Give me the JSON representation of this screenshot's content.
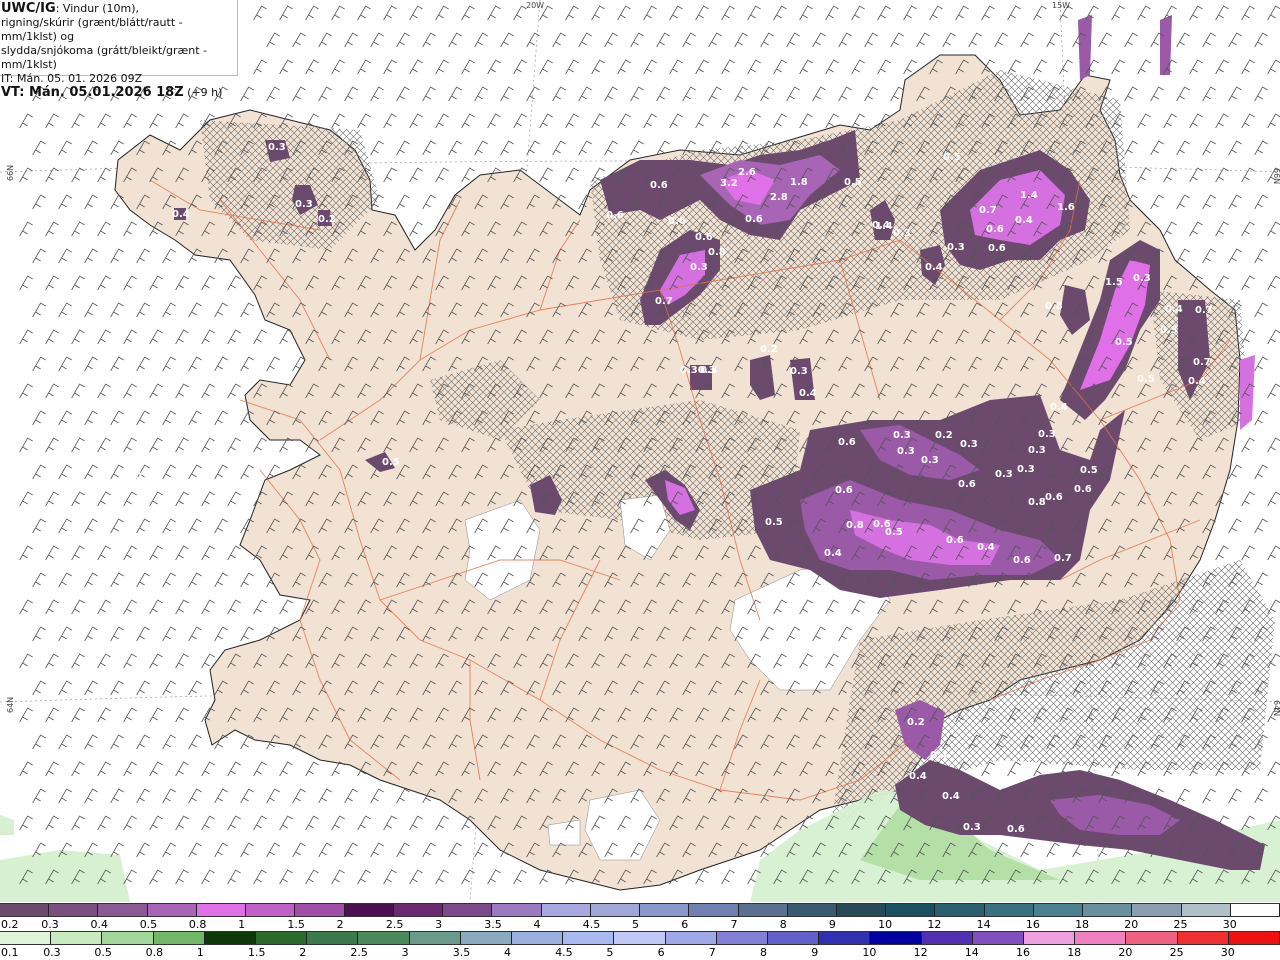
{
  "header": {
    "model": "UWC/IG",
    "line1_rest": ": Vindur (10m),",
    "line2": "rigning/skúrir (grænt/blátt/rautt - mm/1klst) og",
    "line3": "slydda/snjókoma (grátt/bleikt/grænt - mm/1klst)",
    "init": "IT: Mán. 05. 01. 2026 09Z",
    "valid": "VT: Mán. 05.01.2026 18Z",
    "lead": "(+9 h)"
  },
  "coords": {
    "lon_20w": "20W",
    "lon_15w": "15W",
    "lat_66n_left": "66N",
    "lat_66n_right": "66N",
    "lat_64n_left": "64N",
    "lat_64n_right": "64N"
  },
  "colors": {
    "sea": "#ffffff",
    "land": "#f2e2d3",
    "roads": "#e2714a",
    "glacier": "#ffffff",
    "snow_light": "#6b4a6e",
    "snow_mid": "#9a5aa8",
    "snow_heavy": "#d470e0",
    "snow_peak": "#f080f0",
    "rain_light": "#d6f0d0",
    "rain_mid": "#b4e0a8"
  },
  "snow_legend": {
    "values": [
      "0.2",
      "0.3",
      "0.4",
      "0.5",
      "0.8",
      "1",
      "1.5",
      "2",
      "2.5",
      "3",
      "3.5",
      "4",
      "4.5",
      "5",
      "6",
      "7",
      "8",
      "9",
      "10",
      "12",
      "14",
      "16",
      "18",
      "20",
      "25",
      "30"
    ],
    "colors": [
      "#6b4a6e",
      "#7a507f",
      "#8b5a95",
      "#a865b5",
      "#e070e8",
      "#c060c8",
      "#a04ea8",
      "#4a1050",
      "#6a2a70",
      "#7a4a8a",
      "#9a7ac0",
      "#a8a8e0",
      "#a0a8d8",
      "#8898c8",
      "#7080b0",
      "#5a7090",
      "#3a5a70",
      "#284a58",
      "#1a5060",
      "#2a6070",
      "#3a7080",
      "#4a8090",
      "#6a90a0",
      "#8aa0b0",
      "#b0c0c8",
      "#ffffff"
    ]
  },
  "rain_legend": {
    "values": [
      "0.1",
      "0.3",
      "0.5",
      "0.8",
      "1",
      "1.5",
      "2",
      "2.5",
      "3",
      "3.5",
      "4",
      "4.5",
      "5",
      "6",
      "7",
      "8",
      "9",
      "10",
      "12",
      "14",
      "16",
      "18",
      "20",
      "25",
      "30"
    ],
    "colors": [
      "#e0f4dc",
      "#c8ecc0",
      "#a0d898",
      "#70b868",
      "#0a3a0a",
      "#2a6a2a",
      "#3a7a4a",
      "#4a8a5a",
      "#6a9a8a",
      "#8aaac0",
      "#9ab0e0",
      "#a8b8f0",
      "#c0c8f8",
      "#a0a8e8",
      "#8080d8",
      "#6060c8",
      "#3030b0",
      "#0000a0",
      "#5030b0",
      "#8050c0",
      "#f0a0e0",
      "#f080c0",
      "#f06080",
      "#f03030",
      "#f01010"
    ]
  },
  "precip_labels": [
    "0.3",
    "0.3",
    "0.2",
    "0.5",
    "0.3",
    "0.4",
    "0.6",
    "0.6",
    "0.6",
    "3.2",
    "2.6",
    "2.8",
    "1.8",
    "0.5",
    "0.6",
    "0.4",
    "0.3",
    "0.5",
    "0.7",
    "1.4",
    "1.6",
    "0.4",
    "0.3",
    "0.6",
    "0.4",
    "0.6",
    "0.6",
    "0.8",
    "0.7",
    "0.3",
    "0.30.3",
    "0.3",
    "0.2",
    "0.3",
    "0.4",
    "1.4",
    "1.5",
    "0.3",
    "0.5",
    "0.8",
    "0.5",
    "0.3",
    "0.4",
    "0.7",
    "0.4",
    "0.7",
    "0.4",
    "0.3",
    "0.3",
    "0.3",
    "0.3",
    "0.3",
    "0.6",
    "0.6",
    "0.5",
    "0.6",
    "0.8",
    "0.7",
    "0.6",
    "0.4",
    "0.6",
    "0.5",
    "0.6",
    "0.8",
    "0.4",
    "0.5",
    "0.6",
    "0.6",
    "0.3",
    "0.3",
    "0.3",
    "0.2",
    "0.2",
    "0.4",
    "0.4",
    "0.4",
    "0.3",
    "0.6"
  ]
}
